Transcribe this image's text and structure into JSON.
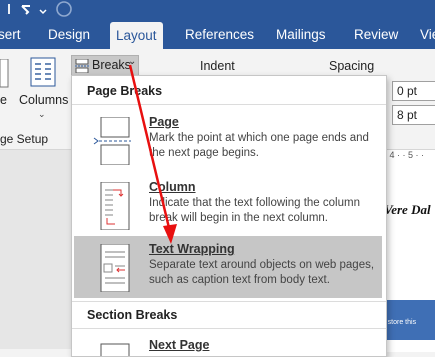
{
  "ribbon_tabs": [
    "sert",
    "Design",
    "Layout",
    "References",
    "Mailings",
    "Review",
    "Vie"
  ],
  "active_tab": "Layout",
  "ribbon": {
    "margins_partial": "e",
    "columns_label": "Columns",
    "breaks_label": "Breaks",
    "page_setup_group": "ge Setup",
    "indent_label": "Indent",
    "spacing_label": "Spacing",
    "spacing_before": "0 pt",
    "spacing_after": "8 pt"
  },
  "document": {
    "visible_text": "Vere Dal",
    "image_caption": "the store this"
  },
  "breaks_menu": {
    "page_breaks_header": "Page Breaks",
    "section_breaks_header": "Section Breaks",
    "items": [
      {
        "icon": "page-break-icon",
        "title": "Page",
        "description": "Mark the point at which one page ends and the next page begins."
      },
      {
        "icon": "column-break-icon",
        "title": "Column",
        "description": "Indicate that the text following the column break will begin in the next column."
      },
      {
        "icon": "text-wrapping-break-icon",
        "title": "Text Wrapping",
        "description": "Separate text around objects on web pages, such as caption text from body text."
      },
      {
        "icon": "next-page-section-icon",
        "title": "Next Page",
        "description": ""
      }
    ]
  },
  "colors": {
    "ribbon_blue": "#2b579a",
    "highlight": "#c6c6c6",
    "annotation_arrow": "#e81010"
  }
}
